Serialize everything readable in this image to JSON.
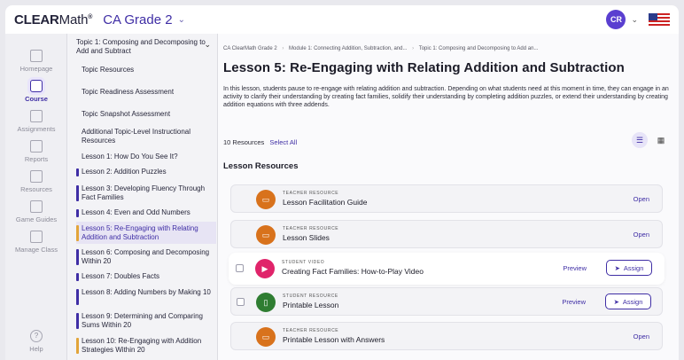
{
  "app": {
    "logo_bold": "CLEAR",
    "logo_light": "Math",
    "logo_tm": "®",
    "grade": "CA Grade 2",
    "avatar_initials": "CR"
  },
  "rail": {
    "items": [
      {
        "label": "Homepage",
        "icon": "home-icon"
      },
      {
        "label": "Course",
        "icon": "course-icon"
      },
      {
        "label": "Assignments",
        "icon": "assignments-icon"
      },
      {
        "label": "Reports",
        "icon": "reports-icon"
      },
      {
        "label": "Resources",
        "icon": "resources-icon"
      },
      {
        "label": "Game Guides",
        "icon": "game-guides-icon"
      },
      {
        "label": "Manage Class",
        "icon": "manage-class-icon"
      }
    ],
    "help_label": "Help"
  },
  "topics": {
    "header": "Topic 1: Composing and Decomposing to Add and Subtract",
    "items": [
      {
        "label": "Topic Resources"
      },
      {
        "label": "Topic Readiness Assessment"
      },
      {
        "label": "Topic Snapshot Assessment"
      },
      {
        "label": "Additional Topic-Level Instructional Resources"
      },
      {
        "label": "Lesson 1: How Do You See It?"
      },
      {
        "label": "Lesson 2: Addition Puzzles"
      },
      {
        "label": "Lesson 3: Developing Fluency Through Fact Families"
      },
      {
        "label": "Lesson 4: Even and Odd Numbers"
      },
      {
        "label": "Lesson 5: Re-Engaging with Relating Addition and Subtraction"
      },
      {
        "label": "Lesson 6: Composing and Decomposing Within 20"
      },
      {
        "label": "Lesson 7: Doubles Facts"
      },
      {
        "label": "Lesson 8: Adding Numbers by Making 10"
      },
      {
        "label": "Lesson 9: Determining and Comparing Sums Within 20"
      },
      {
        "label": "Lesson 10: Re-Engaging with Addition Strategies Within 20"
      }
    ]
  },
  "main": {
    "breadcrumb": [
      "CA ClearMath Grade 2",
      "Module 1: Connecting Addition, Subtraction, and...",
      "Topic 1: Composing and Decomposing to Add an..."
    ],
    "title": "Lesson 5: Re-Engaging with Relating Addition and Subtraction",
    "description": "In this lesson, students pause to re-engage with relating addition and subtraction. Depending on what students need at this moment in time, they can engage in an activity to clarify their understanding by creating fact families, solidify their understanding by completing addition puzzles, or extend their understanding by creating addition equations with three addends.",
    "resource_count": "10 Resources",
    "select_all": "Select All",
    "section_title": "Lesson Resources",
    "resources": [
      {
        "type": "TEACHER RESOURCE",
        "title": "Lesson Facilitation Guide",
        "action": "Open",
        "color": "#d8721c",
        "icon": "book-icon"
      },
      {
        "type": "TEACHER RESOURCE",
        "title": "Lesson Slides",
        "action": "Open",
        "color": "#d8721c",
        "icon": "book-icon"
      },
      {
        "type": "STUDENT VIDEO",
        "title": "Creating Fact Families: How-to-Play Video",
        "preview": "Preview",
        "assign": "Assign",
        "color": "#e0246a",
        "icon": "play-icon"
      },
      {
        "type": "STUDENT RESOURCE",
        "title": "Printable Lesson",
        "preview": "Preview",
        "assign": "Assign",
        "color": "#2f7d32",
        "icon": "document-icon"
      },
      {
        "type": "TEACHER RESOURCE",
        "title": "Printable Lesson with Answers",
        "action": "Open",
        "color": "#d8721c",
        "icon": "book-icon"
      }
    ]
  }
}
